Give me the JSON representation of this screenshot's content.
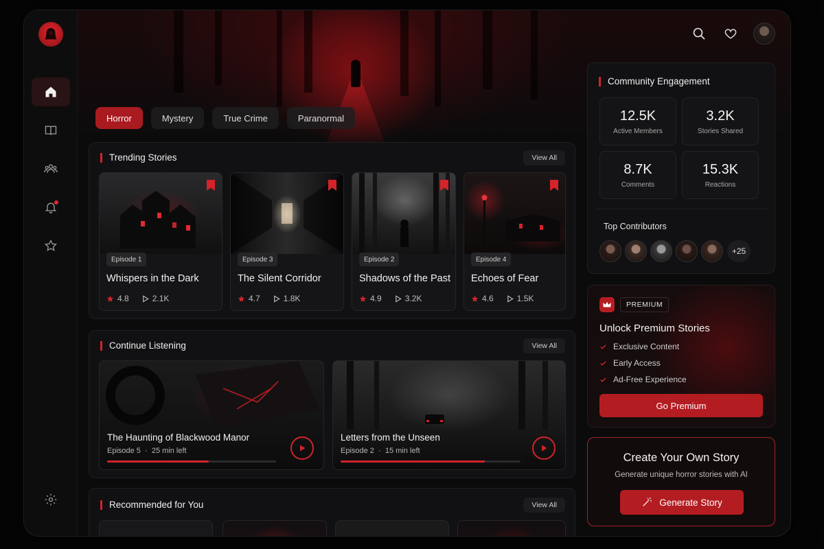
{
  "header": {
    "icons": [
      "search-icon",
      "heart-icon",
      "user-avatar"
    ]
  },
  "sidebar": {
    "items": [
      {
        "icon": "home-icon",
        "active": true
      },
      {
        "icon": "book-icon",
        "active": false
      },
      {
        "icon": "community-icon",
        "active": false
      },
      {
        "icon": "bell-icon",
        "active": false,
        "notification": true
      },
      {
        "icon": "star-icon",
        "active": false
      },
      {
        "icon": "gear-icon",
        "active": false
      }
    ]
  },
  "genres": [
    {
      "label": "Horror",
      "active": true
    },
    {
      "label": "Mystery",
      "active": false
    },
    {
      "label": "True Crime",
      "active": false
    },
    {
      "label": "Paranormal",
      "active": false
    }
  ],
  "trending": {
    "title": "Trending Stories",
    "view_all": "View All",
    "stories": [
      {
        "episode": "Episode 1",
        "title": "Whispers in the Dark",
        "rating": "4.8",
        "plays": "2.1K"
      },
      {
        "episode": "Episode 3",
        "title": "The Silent Corridor",
        "rating": "4.7",
        "plays": "1.8K"
      },
      {
        "episode": "Episode 2",
        "title": "Shadows of the Past",
        "rating": "4.9",
        "plays": "3.2K"
      },
      {
        "episode": "Episode 4",
        "title": "Echoes of Fear",
        "rating": "4.6",
        "plays": "1.5K"
      }
    ]
  },
  "continue": {
    "title": "Continue Listening",
    "view_all": "View All",
    "items": [
      {
        "title": "The Haunting of Blackwood Manor",
        "episode": "Episode 5",
        "time_left": "25 min left",
        "progress": 0.6
      },
      {
        "title": "Letters from the Unseen",
        "episode": "Episode 2",
        "time_left": "15 min left",
        "progress": 0.8
      }
    ]
  },
  "recommended": {
    "title": "Recommended for You",
    "view_all": "View All"
  },
  "community": {
    "title": "Community Engagement",
    "stats": [
      {
        "value": "12.5K",
        "label": "Active Members"
      },
      {
        "value": "3.2K",
        "label": "Stories Shared"
      },
      {
        "value": "8.7K",
        "label": "Comments"
      },
      {
        "value": "15.3K",
        "label": "Reactions"
      }
    ],
    "contributors_title": "Top Contributors",
    "more_count": "+25"
  },
  "premium": {
    "badge": "PREMIUM",
    "title": "Unlock Premium Stories",
    "features": [
      "Exclusive Content",
      "Early Access",
      "Ad-Free Experience"
    ],
    "button": "Go Premium"
  },
  "create": {
    "title": "Create Your Own Story",
    "subtitle": "Generate unique horror stories with AI",
    "button": "Generate Story"
  },
  "colors": {
    "accent": "#d3232a",
    "accent_dark": "#b31d22",
    "background": "#0b0b0c",
    "panel": "#111113"
  }
}
